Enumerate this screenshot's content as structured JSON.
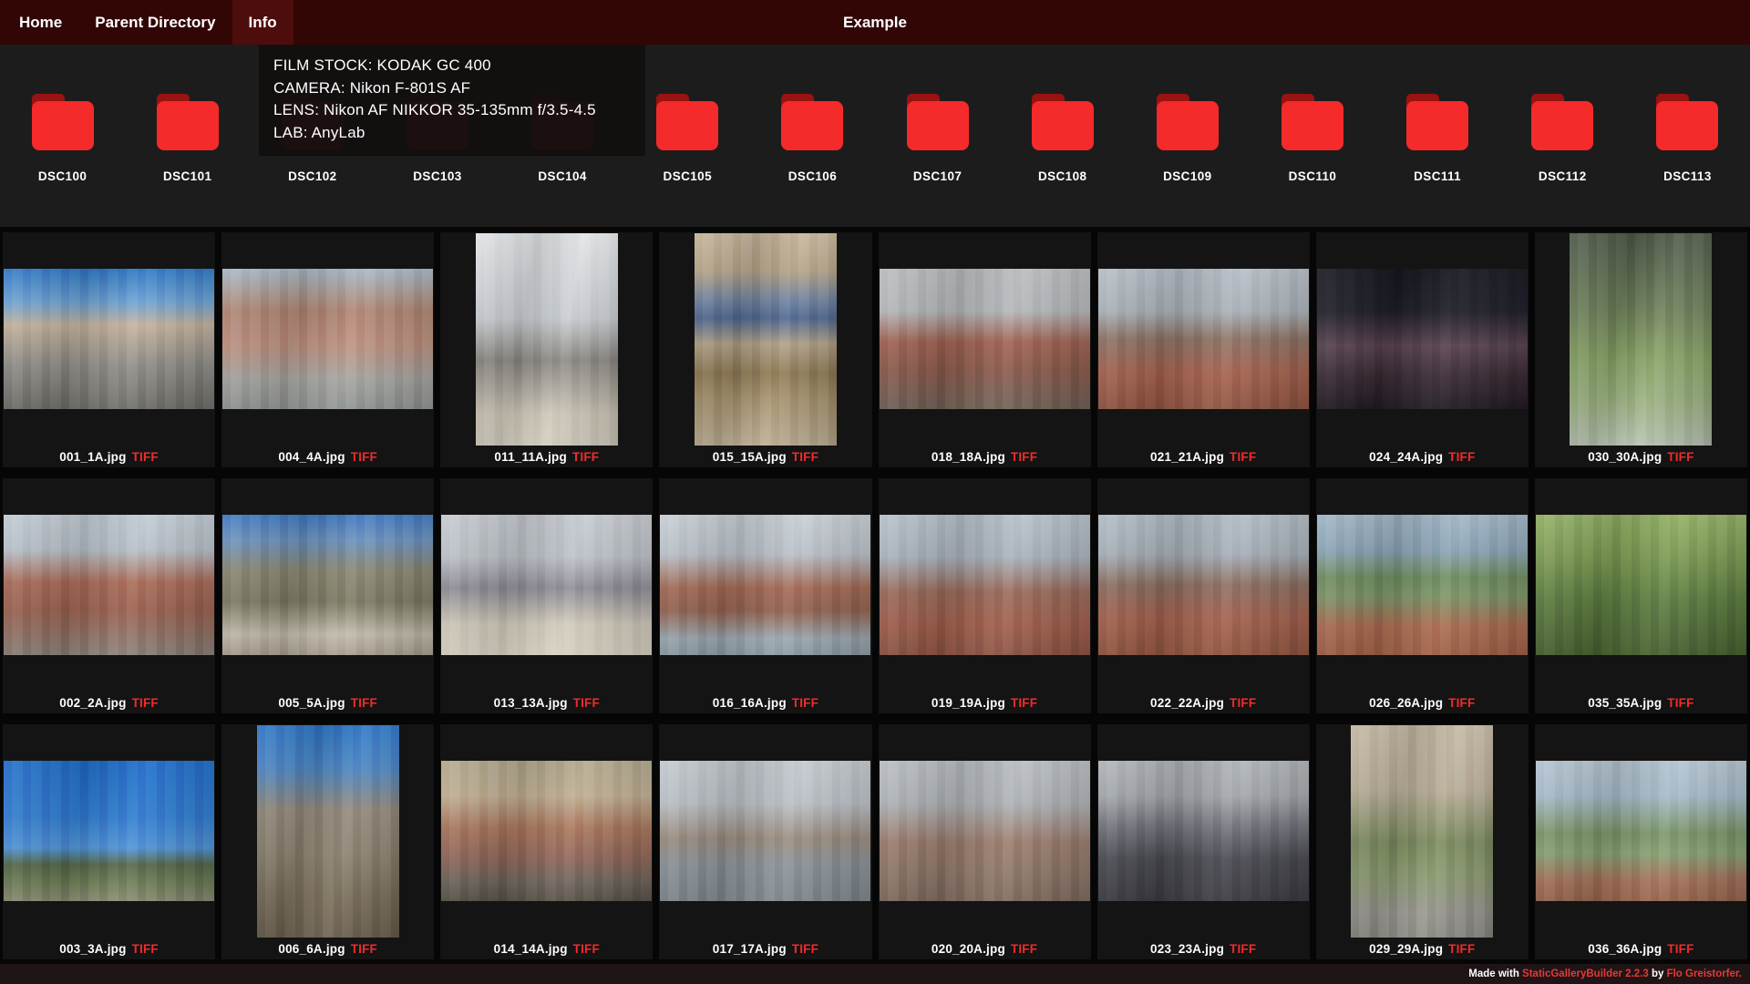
{
  "nav": {
    "items": [
      {
        "label": "Home",
        "active": false
      },
      {
        "label": "Parent Directory",
        "active": false
      },
      {
        "label": "Info",
        "active": true
      }
    ],
    "title": "Example"
  },
  "info_panel": {
    "lines": [
      "FILM STOCK: KODAK GC 400",
      "CAMERA: Nikon F-801S AF",
      "LENS: Nikon AF NIKKOR 35-135mm f/3.5-4.5",
      "LAB: AnyLab"
    ]
  },
  "folders": [
    "DSC100",
    "DSC101",
    "DSC102",
    "DSC103",
    "DSC104",
    "DSC105",
    "DSC106",
    "DSC107",
    "DSC108",
    "DSC109",
    "DSC110",
    "DSC111",
    "DSC112",
    "DSC113"
  ],
  "gallery": {
    "rows": [
      [
        {
          "file": "001_1A.jpg",
          "tag": "TIFF",
          "orient": "l",
          "gradient": [
            [
              "#2e78c6",
              0
            ],
            [
              "#6fa3d4",
              24
            ],
            [
              "#c4b29c",
              40
            ],
            [
              "#908e89",
              68
            ],
            [
              "#6f6d68",
              100
            ]
          ]
        },
        {
          "file": "004_4A.jpg",
          "tag": "TIFF",
          "orient": "l",
          "gradient": [
            [
              "#a9bac6",
              0
            ],
            [
              "#b08573",
              30
            ],
            [
              "#bd9181",
              55
            ],
            [
              "#a5a5a0",
              78
            ],
            [
              "#8f9494",
              100
            ]
          ]
        },
        {
          "file": "011_11A.jpg",
          "tag": "TIFF",
          "orient": "p",
          "gradient": [
            [
              "#e2e5e7",
              0
            ],
            [
              "#c9cdd2",
              40
            ],
            [
              "#8e8a84",
              60
            ],
            [
              "#cec7b8",
              85
            ],
            [
              "#d3cdc0",
              100
            ]
          ]
        },
        {
          "file": "015_15A.jpg",
          "tag": "TIFF",
          "orient": "p",
          "gradient": [
            [
              "#c6b69c",
              0
            ],
            [
              "#b5a489",
              18
            ],
            [
              "#6e82a0",
              32
            ],
            [
              "#4f6890",
              40
            ],
            [
              "#b0a088",
              52
            ],
            [
              "#8f7a55",
              66
            ],
            [
              "#a6936f",
              78
            ],
            [
              "#bdae94",
              100
            ]
          ]
        },
        {
          "file": "018_18A.jpg",
          "tag": "TIFF",
          "orient": "l",
          "gradient": [
            [
              "#babdc0",
              0
            ],
            [
              "#b4b7ba",
              30
            ],
            [
              "#9f6253",
              52
            ],
            [
              "#8c5a4c",
              72
            ],
            [
              "#6e6156",
              100
            ]
          ]
        },
        {
          "file": "021_21A.jpg",
          "tag": "TIFF",
          "orient": "l",
          "gradient": [
            [
              "#b7bfc7",
              0
            ],
            [
              "#a9b2b9",
              30
            ],
            [
              "#8e7365",
              50
            ],
            [
              "#a5614e",
              75
            ],
            [
              "#8f5441",
              100
            ]
          ]
        },
        {
          "file": "024_24A.jpg",
          "tag": "TIFF",
          "orient": "l",
          "gradient": [
            [
              "#16171f",
              0
            ],
            [
              "#1c1d27",
              30
            ],
            [
              "#57414f",
              55
            ],
            [
              "#3a2b35",
              75
            ],
            [
              "#201921",
              100
            ]
          ]
        },
        {
          "file": "030_30A.jpg",
          "tag": "TIFF",
          "orient": "p",
          "gradient": [
            [
              "#4f5a4a",
              0
            ],
            [
              "#6d7f5a",
              35
            ],
            [
              "#8aa468",
              60
            ],
            [
              "#9db284",
              80
            ],
            [
              "#b7c2b2",
              100
            ]
          ]
        }
      ],
      [
        {
          "file": "002_2A.jpg",
          "tag": "TIFF",
          "orient": "l",
          "gradient": [
            [
              "#c3ccd3",
              0
            ],
            [
              "#b7c1c9",
              25
            ],
            [
              "#a96b57",
              48
            ],
            [
              "#9a6150",
              68
            ],
            [
              "#8a8078",
              100
            ]
          ]
        },
        {
          "file": "005_5A.jpg",
          "tag": "TIFF",
          "orient": "l",
          "gradient": [
            [
              "#4079c2",
              0
            ],
            [
              "#6b92bd",
              18
            ],
            [
              "#8a8671",
              40
            ],
            [
              "#7b7a64",
              62
            ],
            [
              "#c2bbab",
              85
            ],
            [
              "#a89f90",
              100
            ]
          ]
        },
        {
          "file": "013_13A.jpg",
          "tag": "TIFF",
          "orient": "l",
          "gradient": [
            [
              "#c7ccd2",
              0
            ],
            [
              "#bdc2c8",
              30
            ],
            [
              "#8f8c96",
              52
            ],
            [
              "#d2cbbc",
              78
            ],
            [
              "#d8d2c3",
              100
            ]
          ]
        },
        {
          "file": "016_16A.jpg",
          "tag": "TIFF",
          "orient": "l",
          "gradient": [
            [
              "#c9cfd5",
              0
            ],
            [
              "#b9c1c8",
              28
            ],
            [
              "#a36a55",
              52
            ],
            [
              "#93624f",
              68
            ],
            [
              "#9aa7af",
              88
            ],
            [
              "#8e9ba3",
              100
            ]
          ]
        },
        {
          "file": "019_19A.jpg",
          "tag": "TIFF",
          "orient": "l",
          "gradient": [
            [
              "#b8c2ca",
              0
            ],
            [
              "#a9b3bb",
              30
            ],
            [
              "#996a5b",
              55
            ],
            [
              "#a05e4b",
              78
            ],
            [
              "#8b5343",
              100
            ]
          ]
        },
        {
          "file": "022_22A.jpg",
          "tag": "TIFF",
          "orient": "l",
          "gradient": [
            [
              "#b3bdc5",
              0
            ],
            [
              "#a5afb7",
              28
            ],
            [
              "#8c6e61",
              50
            ],
            [
              "#a4604d",
              75
            ],
            [
              "#90553f",
              100
            ]
          ]
        },
        {
          "file": "026_26A.jpg",
          "tag": "TIFF",
          "orient": "l",
          "gradient": [
            [
              "#a2b6c6",
              0
            ],
            [
              "#8ba5b8",
              25
            ],
            [
              "#6f8d5e",
              45
            ],
            [
              "#7d9468",
              58
            ],
            [
              "#ab6a50",
              80
            ],
            [
              "#9e5f46",
              100
            ]
          ]
        },
        {
          "file": "035_35A.jpg",
          "tag": "TIFF",
          "orient": "l",
          "gradient": [
            [
              "#93b065",
              0
            ],
            [
              "#7b9a52",
              30
            ],
            [
              "#5d7c40",
              60
            ],
            [
              "#46602f",
              100
            ]
          ]
        }
      ],
      [
        {
          "file": "003_3A.jpg",
          "tag": "TIFF",
          "orient": "l",
          "gradient": [
            [
              "#1f6cc9",
              0
            ],
            [
              "#2f7bd0",
              40
            ],
            [
              "#4f93d8",
              62
            ],
            [
              "#556748",
              74
            ],
            [
              "#6f7e58",
              88
            ],
            [
              "#8a8a72",
              100
            ]
          ]
        },
        {
          "file": "006_6A.jpg",
          "tag": "TIFF",
          "orient": "p",
          "gradient": [
            [
              "#2e76c6",
              0
            ],
            [
              "#4c86c4",
              20
            ],
            [
              "#92897a",
              40
            ],
            [
              "#8a8270",
              60
            ],
            [
              "#7a6f5c",
              80
            ],
            [
              "#6b6050",
              100
            ]
          ]
        },
        {
          "file": "014_14A.jpg",
          "tag": "TIFF",
          "orient": "l",
          "gradient": [
            [
              "#b2a98e",
              0
            ],
            [
              "#c0ae92",
              25
            ],
            [
              "#a9765c",
              48
            ],
            [
              "#93675a",
              68
            ],
            [
              "#6d645a",
              86
            ],
            [
              "#595148",
              100
            ]
          ]
        },
        {
          "file": "017_17A.jpg",
          "tag": "TIFF",
          "orient": "l",
          "gradient": [
            [
              "#c4cacf",
              0
            ],
            [
              "#bac0c6",
              30
            ],
            [
              "#9b8d80",
              55
            ],
            [
              "#8a9298",
              75
            ],
            [
              "#7e878d",
              100
            ]
          ]
        },
        {
          "file": "020_20A.jpg",
          "tag": "TIFF",
          "orient": "l",
          "gradient": [
            [
              "#babec2",
              0
            ],
            [
              "#aeb2b6",
              30
            ],
            [
              "#9b7c6d",
              58
            ],
            [
              "#8d7668",
              80
            ],
            [
              "#7e6a5e",
              100
            ]
          ]
        },
        {
          "file": "023_23A.jpg",
          "tag": "TIFF",
          "orient": "l",
          "gradient": [
            [
              "#b1b5b9",
              0
            ],
            [
              "#a3a7ab",
              25
            ],
            [
              "#71717a",
              48
            ],
            [
              "#4a4a52",
              70
            ],
            [
              "#3a3a41",
              100
            ]
          ]
        },
        {
          "file": "029_29A.jpg",
          "tag": "TIFF",
          "orient": "p",
          "gradient": [
            [
              "#c5b9a4",
              0
            ],
            [
              "#baae9a",
              30
            ],
            [
              "#7d8c60",
              55
            ],
            [
              "#8a9a6e",
              70
            ],
            [
              "#97968f",
              88
            ],
            [
              "#8e8d86",
              100
            ]
          ]
        },
        {
          "file": "036_36A.jpg",
          "tag": "TIFF",
          "orient": "l",
          "gradient": [
            [
              "#b5c5d1",
              0
            ],
            [
              "#a6bac9",
              25
            ],
            [
              "#7b9567",
              52
            ],
            [
              "#87a173",
              66
            ],
            [
              "#a4715a",
              85
            ],
            [
              "#96644d",
              100
            ]
          ]
        }
      ]
    ]
  },
  "footer": {
    "prefix": "Made with ",
    "builder_link": "StaticGalleryBuilder 2.2.3",
    "middle": " by ",
    "author_link": "Flo Greistorfer."
  },
  "colors": {
    "accent_red": "#f02b2b",
    "folder_body_red": "#f52a2a",
    "folder_tab_red": "#9b1212",
    "nav_bg": "#330606",
    "nav_active_bg": "#4d0d0d",
    "link_red": "#e53935"
  }
}
